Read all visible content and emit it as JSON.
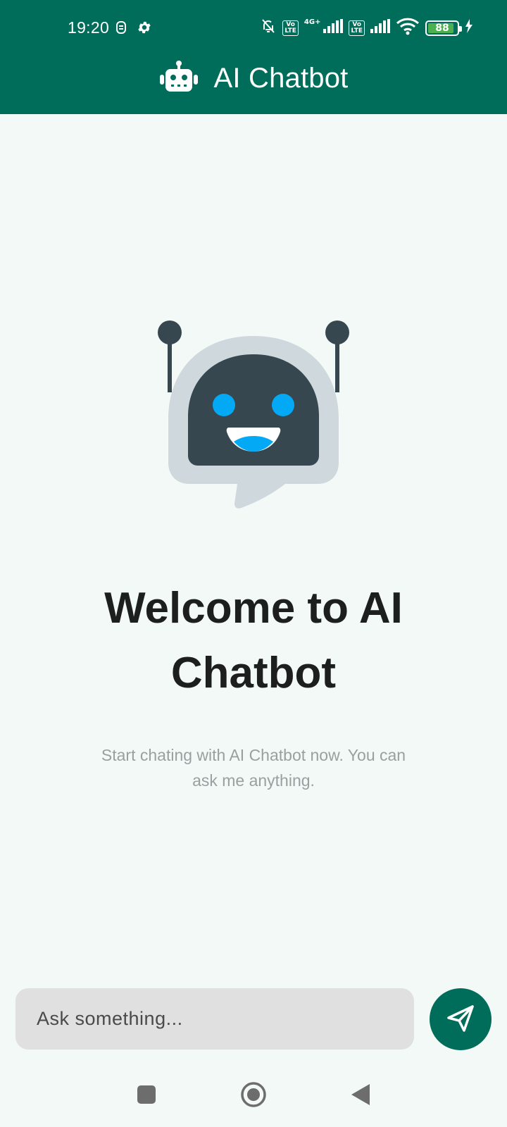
{
  "status_bar": {
    "time": "19:20",
    "battery_level": "88",
    "network_label": "4G+",
    "volte_label_1": "Vo\nLTE",
    "volte_label_2": "Vo\nLTE"
  },
  "app_bar": {
    "title": "AI Chatbot",
    "icon": "robot-icon"
  },
  "welcome": {
    "title": "Welcome to AI Chatbot",
    "subtitle": "Start chating with AI Chatbot now. You can ask me anything.",
    "illustration": "robot-chat-bubble-illustration"
  },
  "composer": {
    "placeholder": "Ask something...",
    "value": "",
    "send_icon": "send-icon"
  },
  "nav": {
    "recents_icon": "recents-icon",
    "home_icon": "home-icon",
    "back_icon": "back-icon"
  },
  "colors": {
    "primary": "#006d5b",
    "background": "#f3f9f7",
    "robot_face": "#37474f",
    "robot_frame": "#cfd8dc",
    "robot_eye": "#03a9f4",
    "input_bg": "#e0e0e0"
  }
}
